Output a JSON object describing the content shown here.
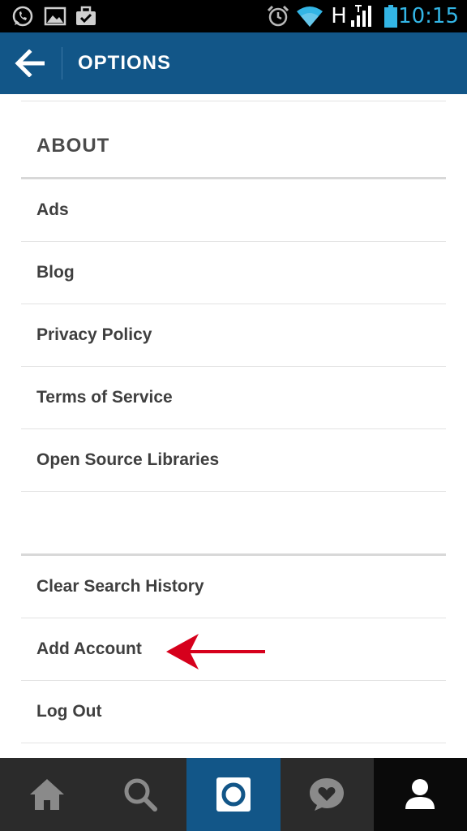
{
  "status_bar": {
    "time": "10:15",
    "network_label": "H",
    "icons": [
      "whatsapp-icon",
      "gallery-icon",
      "briefcase-icon",
      "alarm-icon",
      "wifi-icon",
      "signal-icon",
      "battery-icon"
    ],
    "accent_color": "#33b5e5"
  },
  "header": {
    "title": "OPTIONS",
    "back_icon": "back-arrow-icon",
    "color": "#125688"
  },
  "about_section": {
    "title": "ABOUT",
    "items": [
      {
        "label": "Ads"
      },
      {
        "label": "Blog"
      },
      {
        "label": "Privacy Policy"
      },
      {
        "label": "Terms of Service"
      },
      {
        "label": "Open Source Libraries"
      }
    ]
  },
  "account_section": {
    "items": [
      {
        "label": "Clear Search History"
      },
      {
        "label": "Add Account"
      },
      {
        "label": "Log Out"
      }
    ]
  },
  "annotation": {
    "icon": "red-arrow-icon",
    "color": "#d6001c"
  },
  "bottom_nav": {
    "tabs": [
      {
        "icon": "home-icon"
      },
      {
        "icon": "search-icon"
      },
      {
        "icon": "camera-icon",
        "active_color": "#125688"
      },
      {
        "icon": "activity-heart-icon"
      },
      {
        "icon": "profile-icon",
        "selected": true
      }
    ]
  }
}
